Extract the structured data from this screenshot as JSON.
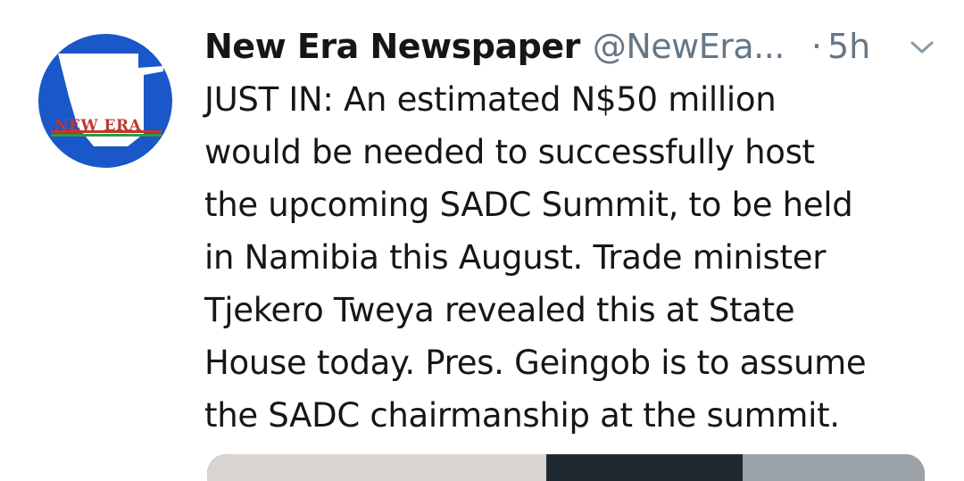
{
  "tweet": {
    "author": {
      "display_name": "New Era Newspaper",
      "handle": "@NewEra...",
      "avatar_label": "NEW ERA"
    },
    "separator": "·",
    "timestamp": "5h",
    "text_lines": [
      "JUST IN: An estimated N$50 million",
      "would be needed to successfully host",
      "the upcoming SADC Summit, to be held",
      "in Namibia this August. Trade minister",
      "Tjekero Tweya revealed this at State",
      "House today. Pres. Geingob is to assume",
      "the SADC chairmanship at the summit."
    ],
    "menu_icon": "chevron-down-icon"
  },
  "colors": {
    "text_primary": "#14171a",
    "text_secondary": "#657786",
    "avatar_blue": "#1a57c8",
    "avatar_red": "#c0392b",
    "avatar_green": "#2e9b47"
  }
}
